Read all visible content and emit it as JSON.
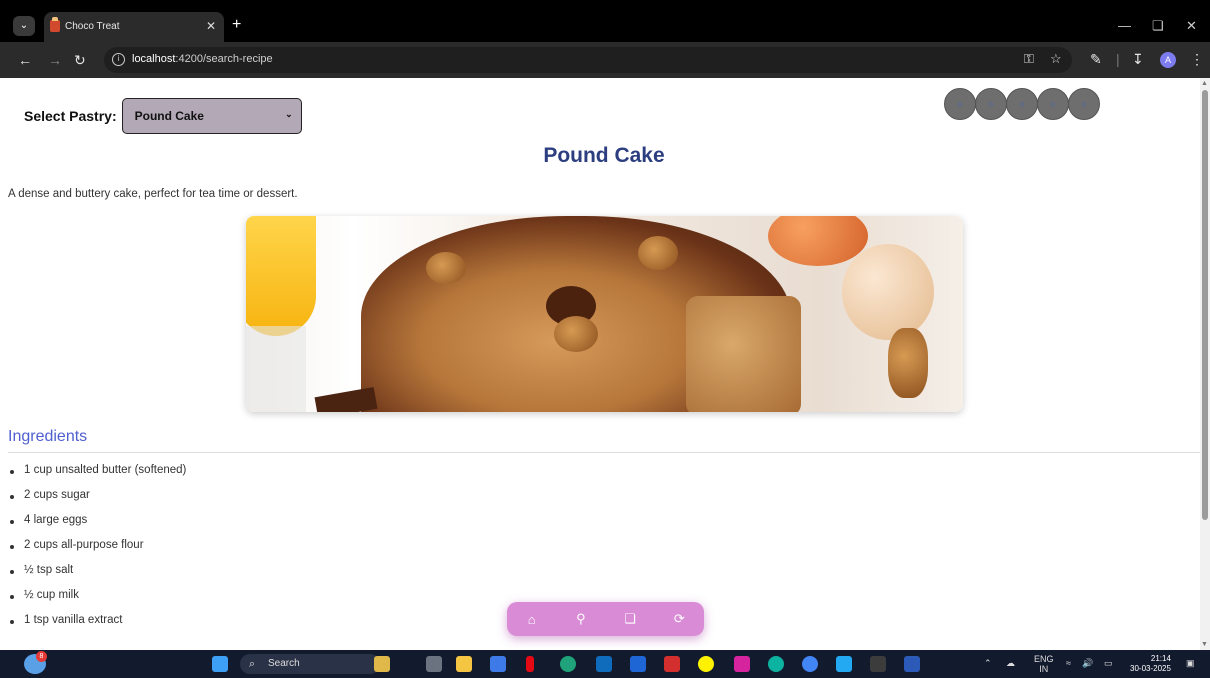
{
  "browser": {
    "tab_title": "Choco Treat",
    "url_host": "localhost",
    "url_rest": ":4200/search-recipe",
    "avatar_letter": "A"
  },
  "page": {
    "select_label": "Select Pastry:",
    "selected_pastry": "Pound Cake",
    "title": "Pound Cake",
    "description": "A dense and buttery cake, perfect for tea time or dessert.",
    "ingredients_heading": "Ingredients",
    "ingredients": [
      "1 cup unsalted butter (softened)",
      "2 cups sugar",
      "4 large eggs",
      "2 cups all-purpose flour",
      "½ tsp salt",
      "½ cup milk",
      "1 tsp vanilla extract"
    ],
    "nav_icons": [
      "home-icon",
      "search-icon",
      "cart-icon",
      "logout-icon"
    ]
  },
  "taskbar": {
    "search_placeholder": "Search",
    "lang": "ENG",
    "region": "IN",
    "time": "21:14",
    "date": "30-03-2025",
    "weather_badge": "8"
  },
  "colors": {
    "title": "#2c3e80",
    "ingredients_heading": "#4f5fcf",
    "bottom_nav": "#d98bd6",
    "select_bg": "#b3a8b6"
  }
}
